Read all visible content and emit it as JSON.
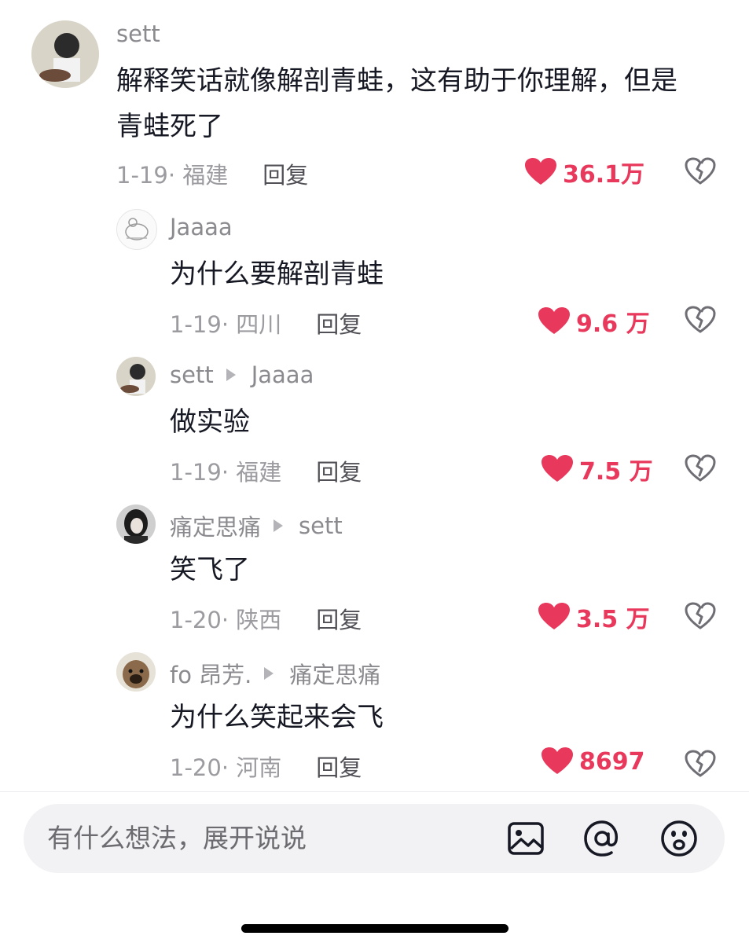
{
  "comments": [
    {
      "user": "sett",
      "reply_to": "",
      "text_line1": "解释笑话就像解剖青蛙，这有助于你理解，但是",
      "text_line2": "青蛙死了",
      "date_location": "1-19· 福建",
      "reply_label": "回复",
      "likes": "36.1万"
    },
    {
      "user": "Jaaaa",
      "reply_to": "",
      "text_line1": "为什么要解剖青蛙",
      "date_location": "1-19· 四川",
      "reply_label": "回复",
      "likes": "9.6 万"
    },
    {
      "user": "sett",
      "reply_to": "Jaaaa",
      "text_line1": "做实验",
      "date_location": "1-19· 福建",
      "reply_label": "回复",
      "likes": "7.5 万"
    },
    {
      "user": "痛定思痛",
      "reply_to": "sett",
      "text_line1": "笑飞了",
      "date_location": "1-20· 陕西",
      "reply_label": "回复",
      "likes": "3.5 万"
    },
    {
      "user": "fo 昂芳.",
      "reply_to": "痛定思痛",
      "text_line1": "为什么笑起来会飞",
      "date_location": "1-20· 河南",
      "reply_label": "回复",
      "likes": "8697"
    }
  ],
  "input": {
    "placeholder": "有什么想法，展开说说"
  },
  "icons": {
    "like": "heart-icon",
    "dislike": "broken-heart-icon",
    "image": "image-icon",
    "mention": "at-icon",
    "emoji": "emoji-icon"
  },
  "colors": {
    "like": "#e8385b",
    "meta": "#9b9ba0",
    "username": "#8a8a8f"
  }
}
